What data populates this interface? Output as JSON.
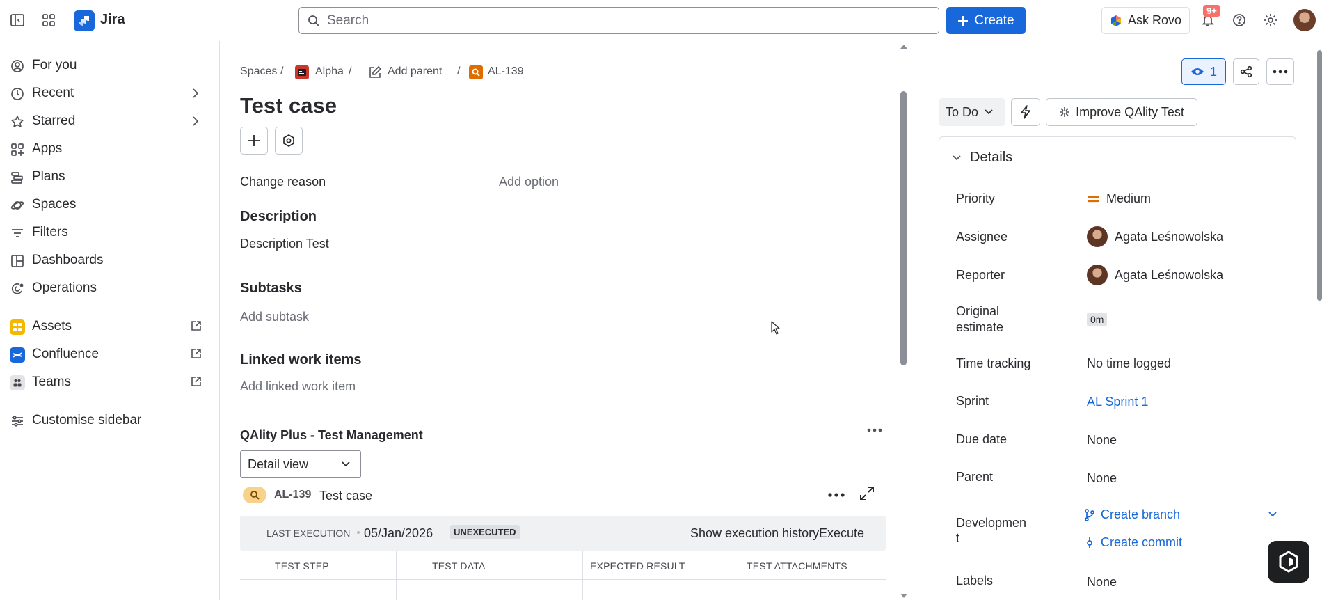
{
  "topbar": {
    "brand": "Jira",
    "search_placeholder": "Search",
    "create_label": "Create",
    "ask_rovo_label": "Ask Rovo",
    "notifications_badge": "9+"
  },
  "sidebar": {
    "items": [
      {
        "label": "For you",
        "icon": "user-circle-icon"
      },
      {
        "label": "Recent",
        "icon": "clock-icon"
      },
      {
        "label": "Starred",
        "icon": "star-icon"
      },
      {
        "label": "Apps",
        "icon": "apps-icon"
      },
      {
        "label": "Plans",
        "icon": "plans-icon"
      },
      {
        "label": "Spaces",
        "icon": "planet-icon"
      },
      {
        "label": "Filters",
        "icon": "filter-icon"
      },
      {
        "label": "Dashboards",
        "icon": "dashboard-icon"
      },
      {
        "label": "Operations",
        "icon": "operations-icon"
      }
    ],
    "apps": [
      {
        "label": "Assets",
        "color": "#f5b800"
      },
      {
        "label": "Confluence",
        "color": "#1868db"
      },
      {
        "label": "Teams",
        "color": "#e2e3e5"
      }
    ],
    "customise_label": "Customise sidebar"
  },
  "breadcrumb": {
    "spaces": "Spaces",
    "project": "Alpha",
    "add_parent": "Add parent",
    "issue_key": "AL-139",
    "separator": "/"
  },
  "issue": {
    "title": "Test case",
    "change_reason_label": "Change reason",
    "add_option": "Add option",
    "description_heading": "Description",
    "description_text": "Description Test",
    "subtasks_heading": "Subtasks",
    "add_subtask": "Add subtask",
    "linked_heading": "Linked work items",
    "add_linked": "Add linked work item"
  },
  "qality": {
    "title": "QAlity Plus - Test Management",
    "view_select": "Detail view",
    "issue_key": "AL-139",
    "issue_name": "Test case",
    "last_execution_label": "LAST EXECUTION",
    "last_execution_date": "05/Jan/2026",
    "status_badge": "UNEXECUTED",
    "show_history": "Show execution history",
    "execute": "Execute",
    "columns": [
      "TEST STEP",
      "TEST DATA",
      "EXPECTED RESULT",
      "TEST ATTACHMENTS"
    ]
  },
  "right": {
    "watchers_count": "1",
    "status": "To Do",
    "improve_label": "Improve QAlity Test",
    "details_heading": "Details",
    "fields": {
      "priority_label": "Priority",
      "priority_value": "Medium",
      "assignee_label": "Assignee",
      "assignee_value": "Agata Leśnowolska",
      "reporter_label": "Reporter",
      "reporter_value": "Agata Leśnowolska",
      "estimate_label_1": "Original",
      "estimate_label_2": "estimate",
      "estimate_value": "0m",
      "time_label": "Time tracking",
      "time_value": "No time logged",
      "sprint_label": "Sprint",
      "sprint_value": "AL Sprint 1",
      "due_label": "Due date",
      "due_value": "None",
      "parent_label": "Parent",
      "parent_value": "None",
      "dev_label_1": "Developmen",
      "dev_label_2": "t",
      "create_branch": "Create branch",
      "create_commit": "Create commit",
      "labels_label": "Labels",
      "labels_value": "None"
    }
  },
  "colors": {
    "accent": "#1868db",
    "priority_medium": "#e06c00",
    "badge": "#f87168"
  }
}
